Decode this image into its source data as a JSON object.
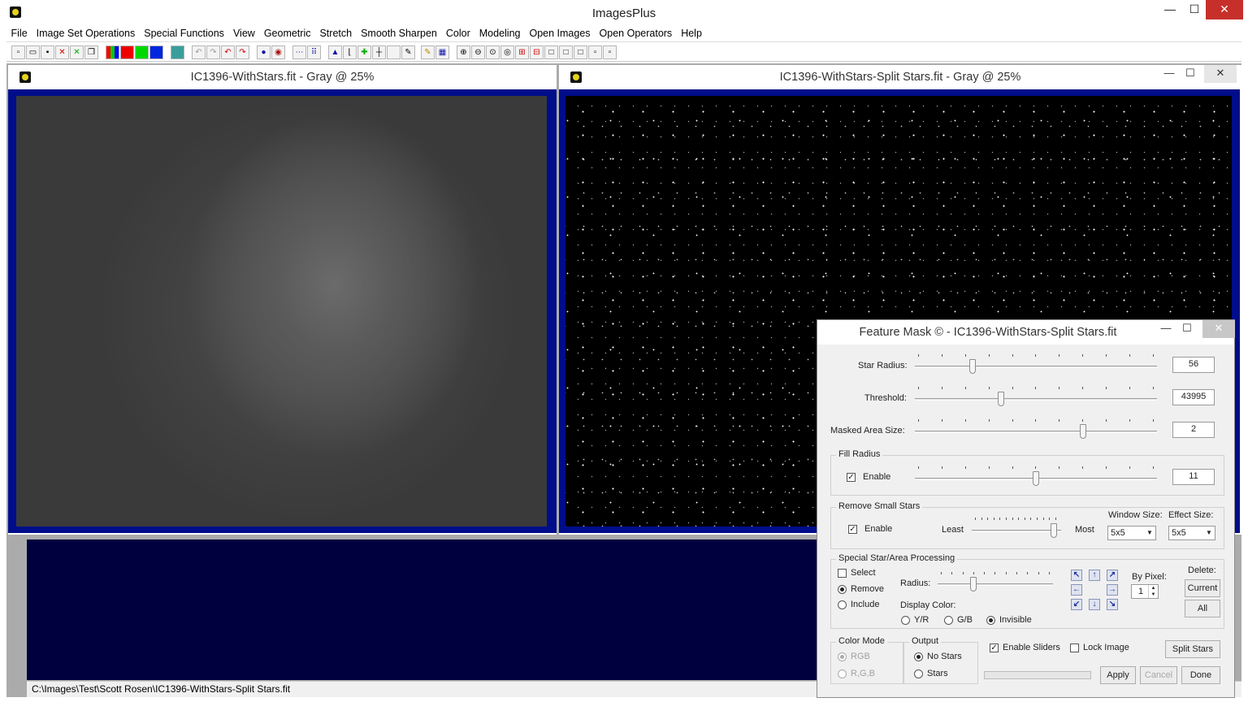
{
  "app": {
    "title": "ImagesPlus"
  },
  "window_buttons": {
    "minimize": "—",
    "maximize": "☐",
    "close": "✕"
  },
  "menu": [
    "File",
    "Image Set Operations",
    "Special Functions",
    "View",
    "Geometric",
    "Stretch",
    "Smooth Sharpen",
    "Color",
    "Modeling",
    "Open Images",
    "Open Operators",
    "Help"
  ],
  "windows": [
    {
      "title": "IC1396-WithStars.fit - Gray @ 25%"
    },
    {
      "title": "IC1396-WithStars-Split Stars.fit - Gray @ 25%"
    }
  ],
  "status": {
    "path": "C:\\Images\\Test\\Scott Rosen\\IC1396-WithStars-Split Stars.fit"
  },
  "dialog": {
    "title": "Feature Mask © - IC1396-WithStars-Split Stars.fit",
    "star_radius": {
      "label": "Star Radius:",
      "value": "56",
      "level": 0.23
    },
    "threshold": {
      "label": "Threshold:",
      "value": "43995",
      "level": 0.35
    },
    "masked_area": {
      "label": "Masked Area Size:",
      "value": "2",
      "level": 0.7
    },
    "fill_radius": {
      "group": "Fill Radius",
      "enable": "Enable",
      "enabled": true,
      "value": "11",
      "level": 0.5
    },
    "remove_small": {
      "group": "Remove Small Stars",
      "enable": "Enable",
      "enabled": true,
      "least": "Least",
      "most": "Most",
      "level": 0.95,
      "window_size_label": "Window Size:",
      "window_size": "5x5",
      "effect_size_label": "Effect Size:",
      "effect_size": "5x5"
    },
    "special": {
      "group": "Special Star/Area Processing",
      "select": "Select",
      "remove": "Remove",
      "include": "Include",
      "selected_mode": "Remove",
      "radius": "Radius:",
      "radius_level": 0.3,
      "display_color": "Display Color:",
      "colors": [
        "Y/R",
        "G/B",
        "Invisible"
      ],
      "selected_color": "Invisible",
      "by_pixel": "By Pixel:",
      "by_pixel_value": "1",
      "delete": "Delete:",
      "current": "Current",
      "all": "All"
    },
    "color_mode": {
      "group": "Color Mode",
      "rgb": "RGB",
      "rgb2": "R,G,B"
    },
    "output": {
      "group": "Output",
      "no_stars": "No Stars",
      "stars": "Stars",
      "selected": "No Stars"
    },
    "enable_sliders": "Enable Sliders",
    "lock_image": "Lock Image",
    "split_stars": "Split Stars",
    "apply": "Apply",
    "cancel": "Cancel",
    "done": "Done"
  },
  "icons": {
    "toolbar": [
      "new-file-icon",
      "open-folder-icon",
      "save-icon",
      "close-red-icon",
      "close-green-icon",
      "copy-icon",
      "rgb-icon",
      "red-channel-icon",
      "green-channel-icon",
      "blue-channel-icon",
      "grid-icon",
      "undo-icon",
      "redo-icon",
      "undo-red-icon",
      "redo-red-icon",
      "circle-icon",
      "ring-icon",
      "dots-icon",
      "scatter-icon",
      "histogram-icon",
      "curve-icon",
      "crosshair-green-icon",
      "crosshair-icon",
      "blank-icon",
      "pencil-icon",
      "grid-blue-icon",
      "zoom-in-icon",
      "zoom-out-icon",
      "zoom-fit-icon",
      "zoom-actual-icon",
      "plus-box-icon",
      "minus-box-icon",
      "frame1-icon",
      "frame2-icon",
      "frame3-icon",
      "frame4-icon",
      "frame5-icon"
    ]
  }
}
